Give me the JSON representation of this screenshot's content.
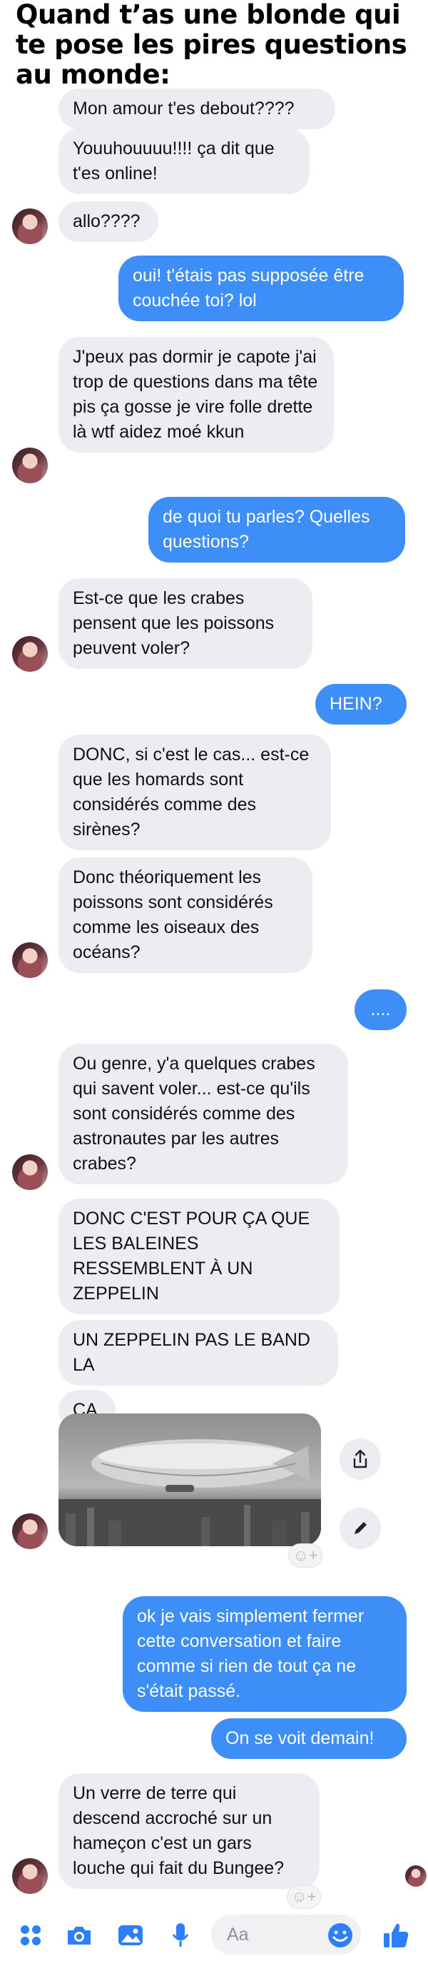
{
  "caption": "Quand t’as une blonde qui te pose les pires questions au monde:",
  "messages": [
    {
      "side": "in",
      "text": "Mon amour t'es debout????"
    },
    {
      "side": "in",
      "text": "Youuhouuuu!!!! ça dit que t'es online!"
    },
    {
      "side": "in",
      "text": "allo????"
    },
    {
      "side": "out",
      "text": "oui! t'étais pas supposée être couchée toi? lol"
    },
    {
      "side": "in",
      "text": "J'peux pas dormir je capote j'ai trop de questions dans ma tête pis ça gosse je vire folle drette là wtf aidez moé kkun"
    },
    {
      "side": "out",
      "text": "de quoi tu parles? Quelles questions?"
    },
    {
      "side": "in",
      "text": "Est-ce que les crabes pensent que les poissons peuvent voler?"
    },
    {
      "side": "out",
      "text": "HEIN?"
    },
    {
      "side": "in",
      "text": "DONC, si c'est le cas... est-ce que les homards sont considérés comme des sirènes?"
    },
    {
      "side": "in",
      "text": "Donc théoriquement les poissons sont considérés comme les oiseaux des océans?"
    },
    {
      "side": "out",
      "text": "...."
    },
    {
      "side": "in",
      "text": "Ou genre, y'a quelques crabes qui savent voler... est-ce qu'ils sont considérés comme des astronautes par les autres crabes?"
    },
    {
      "side": "in",
      "text": "DONC C'EST POUR ÇA QUE LES BALEINES RESSEMBLENT À UN ZEPPELIN"
    },
    {
      "side": "in",
      "text": "UN ZEPPELIN PAS LE BAND LA"
    },
    {
      "side": "in",
      "text": "ÇA"
    },
    {
      "side": "out",
      "text": "ok je vais simplement fermer cette conversation et faire comme si rien de tout ça ne s'était passé."
    },
    {
      "side": "out",
      "text": "On se voit demain!"
    },
    {
      "side": "in",
      "text": "Un verre de terre qui descend accroché sur un hameçon c'est un gars louche qui fait du Bungee?"
    }
  ],
  "attachment": {
    "type": "photo",
    "subject": "zeppelin"
  },
  "composer": {
    "placeholder": "Aa"
  },
  "icons": {
    "menu": "apps-icon",
    "camera": "camera-icon",
    "gallery": "image-icon",
    "mic": "microphone-icon",
    "emoji": "emoji-icon",
    "like": "thumbs-up-icon",
    "share": "share-icon",
    "edit": "pencil-icon",
    "react": "add-reaction-icon"
  },
  "colors": {
    "outgoing": "#3d8ff7",
    "incoming": "#ecedf0",
    "accent": "#2d7ff9"
  }
}
